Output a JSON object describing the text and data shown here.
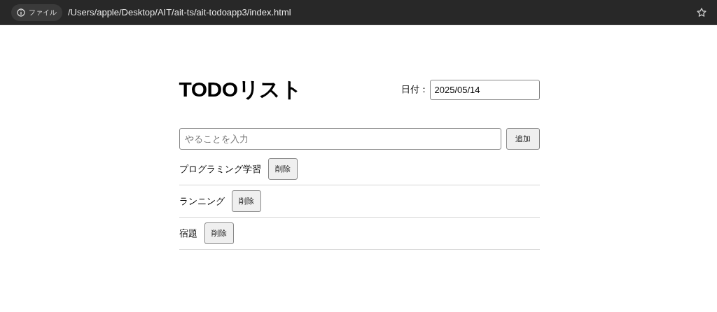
{
  "browser": {
    "scheme_label": "ファイル",
    "url": "/Users/apple/Desktop/AIT/ait-ts/ait-todoapp3/index.html"
  },
  "page": {
    "title": "TODOリスト",
    "date_label": "日付：",
    "date_value": "2025/05/14",
    "task_input": {
      "placeholder": "やることを入力"
    },
    "add_button": "追加",
    "todos": [
      {
        "text": "プログラミング学習",
        "delete_button": "削除"
      },
      {
        "text": "ランニング",
        "delete_button": "削除"
      },
      {
        "text": "宿題",
        "delete_button": "削除"
      }
    ]
  }
}
